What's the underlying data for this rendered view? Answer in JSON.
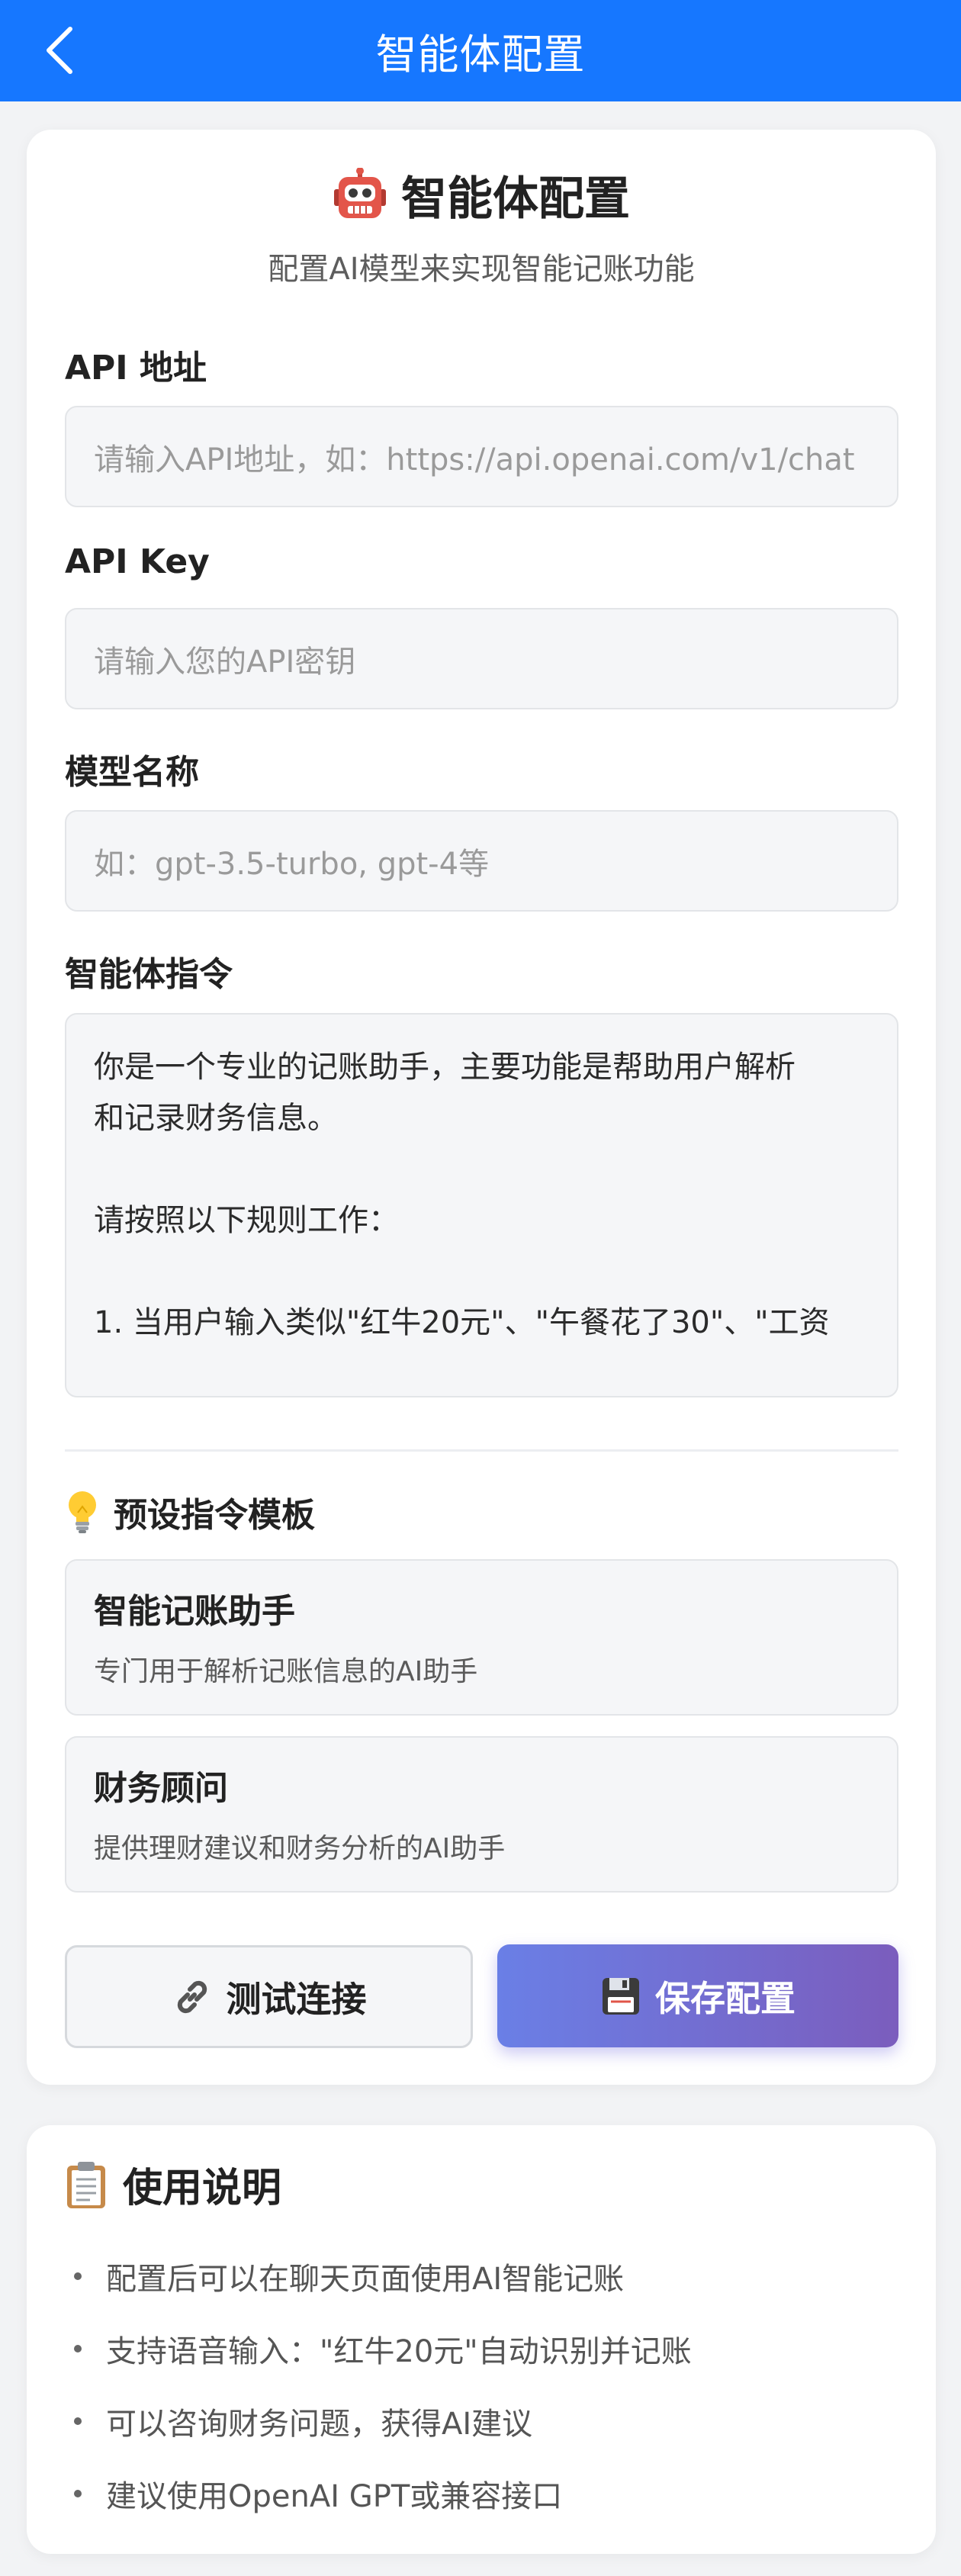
{
  "navbar": {
    "title": "智能体配置",
    "back_icon": "chevron-left-icon",
    "background": "#1677ff"
  },
  "hero": {
    "title": "智能体配置",
    "icon": "robot-icon",
    "subtitle": "配置AI模型来实现智能记账功能"
  },
  "form": {
    "api_url": {
      "label": "API 地址",
      "placeholder": "请输入API地址，如：https://api.openai.com/v1/chat",
      "value": ""
    },
    "api_key": {
      "label": "API Key",
      "placeholder": "请输入您的API密钥",
      "value": ""
    },
    "model": {
      "label": "模型名称",
      "placeholder": "如：gpt-3.5-turbo, gpt-4等",
      "value": ""
    },
    "prompt": {
      "label": "智能体指令",
      "lines": [
        "你是一个专业的记账助手，主要功能是帮助用户解析",
        "和记录财务信息。",
        "",
        "请按照以下规则工作：",
        "",
        "1. 当用户输入类似\"红牛20元\"、\"午餐花了30\"、\"工资"
      ]
    }
  },
  "templates": {
    "title": "预设指令模板",
    "icon": "lightbulb-icon",
    "items": [
      {
        "title": "智能记账助手",
        "desc": "专门用于解析记账信息的AI助手"
      },
      {
        "title": "财务顾问",
        "desc": "提供理财建议和财务分析的AI助手"
      }
    ]
  },
  "actions": {
    "test_label": "测试连接",
    "test_icon": "link-icon",
    "save_label": "保存配置",
    "save_icon": "floppy-disk-icon",
    "save_gradient": [
      "#6a7fe6",
      "#7b5dbd"
    ]
  },
  "help": {
    "title": "使用说明",
    "icon": "clipboard-icon",
    "items": [
      "配置后可以在聊天页面使用AI智能记账",
      "支持语音输入：\"红牛20元\"自动识别并记账",
      "可以咨询财务问题，获得AI建议",
      "建议使用OpenAI GPT或兼容接口"
    ]
  }
}
